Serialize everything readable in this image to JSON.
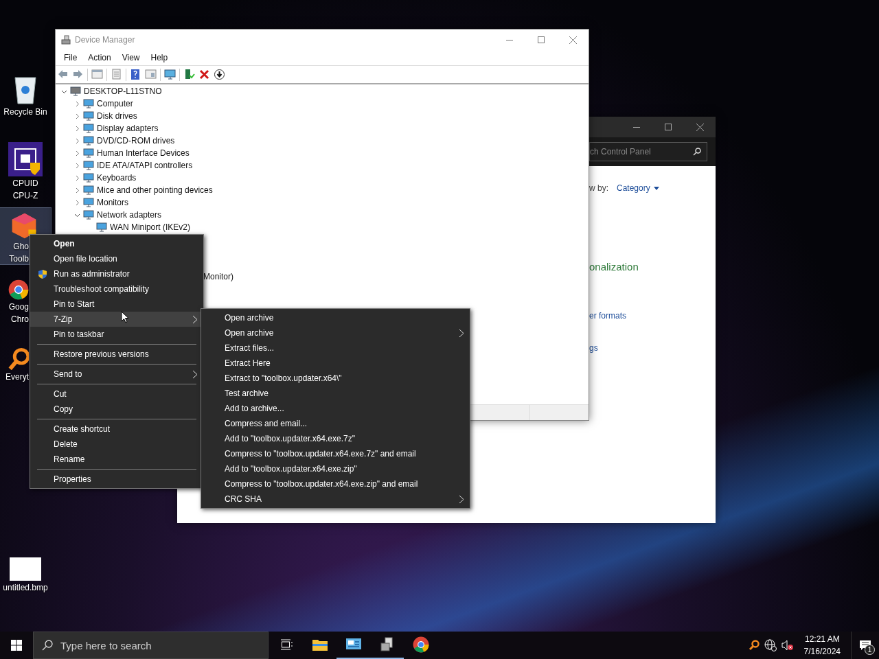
{
  "desktop_icons": [
    {
      "kind": "recycle-bin",
      "lines": [
        "Recycle Bin"
      ],
      "selected": false,
      "clipped": false
    },
    {
      "kind": "cpu-z",
      "lines": [
        "CPUID",
        "CPU-Z"
      ],
      "selected": false,
      "clipped": false
    },
    {
      "kind": "toolbox",
      "lines": [
        "Gho",
        "Toolb"
      ],
      "selected": true,
      "clipped": true
    },
    {
      "kind": "chrome",
      "lines": [
        "Goog",
        "Chro"
      ],
      "selected": false,
      "clipped": true
    },
    {
      "kind": "everything",
      "lines": [
        "Everyt"
      ],
      "selected": false,
      "clipped": true
    },
    {
      "kind": "bitmap",
      "lines": [
        "untitled.bmp"
      ],
      "selected": false,
      "clipped": false
    }
  ],
  "control_panel": {
    "search_placeholder": "ch Control Panel",
    "view_by_label": "w by:",
    "view_by_value": "Category",
    "heading": "onalization",
    "links": [
      "er formats",
      "gs"
    ]
  },
  "device_manager": {
    "title": "Device Manager",
    "menu": [
      "File",
      "Action",
      "View",
      "Help"
    ],
    "tree": {
      "label": "DESKTOP-L11STNO",
      "expanded": true,
      "children": [
        {
          "label": "Computer",
          "expanded": false
        },
        {
          "label": "Disk drives",
          "expanded": false
        },
        {
          "label": "Display adapters",
          "expanded": false
        },
        {
          "label": "DVD/CD-ROM drives",
          "expanded": false
        },
        {
          "label": "Human Interface Devices",
          "expanded": false
        },
        {
          "label": "IDE ATA/ATAPI controllers",
          "expanded": false
        },
        {
          "label": "Keyboards",
          "expanded": false
        },
        {
          "label": "Mice and other pointing devices",
          "expanded": false
        },
        {
          "label": "Monitors",
          "expanded": false
        },
        {
          "label": "Network adapters",
          "expanded": true,
          "children": [
            {
              "label": "WAN Miniport (IKEv2)",
              "kind": "device"
            },
            {
              "label": "Monitor)",
              "kind": "clipped"
            }
          ]
        }
      ]
    }
  },
  "context_menu": [
    {
      "kind": "item",
      "label": "Open",
      "default": true,
      "selected": false
    },
    {
      "kind": "item",
      "label": "Open file location",
      "default": false,
      "selected": false
    },
    {
      "kind": "admin",
      "label": "Run as administrator",
      "default": false,
      "selected": false
    },
    {
      "kind": "item",
      "label": "Troubleshoot compatibility",
      "default": false,
      "selected": false
    },
    {
      "kind": "item",
      "label": "Pin to Start",
      "default": false,
      "selected": false
    },
    {
      "kind": "submenu",
      "label": "7-Zip",
      "default": false,
      "selected": true
    },
    {
      "kind": "item",
      "label": "Pin to taskbar",
      "default": false,
      "selected": false
    },
    {
      "kind": "separator"
    },
    {
      "kind": "item",
      "label": "Restore previous versions",
      "default": false,
      "selected": false
    },
    {
      "kind": "separator"
    },
    {
      "kind": "submenu",
      "label": "Send to",
      "default": false,
      "selected": false
    },
    {
      "kind": "separator"
    },
    {
      "kind": "item",
      "label": "Cut",
      "default": false,
      "selected": false
    },
    {
      "kind": "item",
      "label": "Copy",
      "default": false,
      "selected": false
    },
    {
      "kind": "separator"
    },
    {
      "kind": "item",
      "label": "Create shortcut",
      "default": false,
      "selected": false
    },
    {
      "kind": "item",
      "label": "Delete",
      "default": false,
      "selected": false
    },
    {
      "kind": "item",
      "label": "Rename",
      "default": false,
      "selected": false
    },
    {
      "kind": "separator"
    },
    {
      "kind": "item",
      "label": "Properties",
      "default": false,
      "selected": false
    }
  ],
  "submenu": [
    {
      "kind": "item",
      "label": "Open archive"
    },
    {
      "kind": "submenu",
      "label": "Open archive"
    },
    {
      "kind": "item",
      "label": "Extract files..."
    },
    {
      "kind": "item",
      "label": "Extract Here"
    },
    {
      "kind": "item",
      "label": "Extract to \"toolbox.updater.x64\\\""
    },
    {
      "kind": "item",
      "label": "Test archive"
    },
    {
      "kind": "item",
      "label": "Add to archive..."
    },
    {
      "kind": "item",
      "label": "Compress and email..."
    },
    {
      "kind": "item",
      "label": "Add to \"toolbox.updater.x64.exe.7z\""
    },
    {
      "kind": "item",
      "label": "Compress to \"toolbox.updater.x64.exe.7z\" and email"
    },
    {
      "kind": "item",
      "label": "Add to \"toolbox.updater.x64.exe.zip\""
    },
    {
      "kind": "item",
      "label": "Compress to \"toolbox.updater.x64.exe.zip\" and email"
    },
    {
      "kind": "submenu",
      "label": "CRC SHA"
    }
  ],
  "taskbar": {
    "search_placeholder": "Type here to search",
    "apps": [
      {
        "kind": "task-view",
        "running": false
      },
      {
        "kind": "explorer",
        "running": false
      },
      {
        "kind": "control-panel",
        "running": true
      },
      {
        "kind": "device-manager",
        "running": true
      },
      {
        "kind": "chrome",
        "running": false
      }
    ],
    "time": "12:21 AM",
    "date": "7/16/2024",
    "notification_count": "1"
  }
}
